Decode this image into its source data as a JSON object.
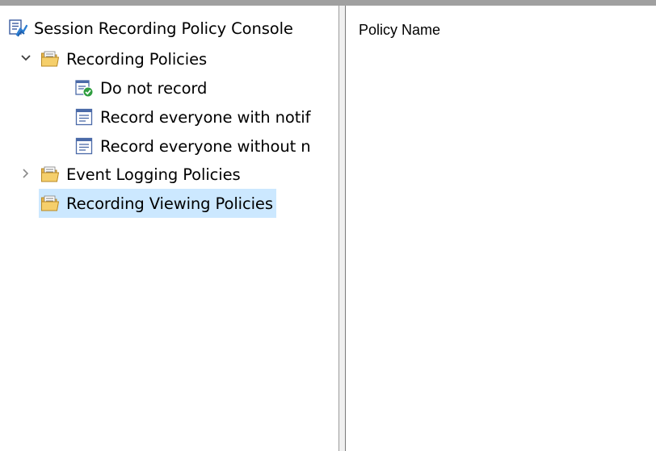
{
  "tree": {
    "root": {
      "label": "Session Recording Policy Console",
      "icon": "console-icon"
    },
    "recording_policies": {
      "label": "Recording Policies",
      "icon": "folder-icon",
      "expanded": true,
      "children": [
        {
          "label": "Do not record",
          "icon": "active-policy-icon",
          "active": true
        },
        {
          "label": "Record everyone with notif",
          "icon": "policy-icon"
        },
        {
          "label": "Record everyone without n",
          "icon": "policy-icon"
        }
      ]
    },
    "event_logging_policies": {
      "label": "Event Logging Policies",
      "icon": "folder-icon",
      "expanded": false
    },
    "recording_viewing_policies": {
      "label": "Recording Viewing Policies",
      "icon": "folder-icon",
      "selected": true
    }
  },
  "details": {
    "column_header": "Policy Name"
  },
  "colors": {
    "selection": "#cce8ff",
    "splitter": "#f0f0f0",
    "folder": "#f3c35a",
    "active_check": "#2f9e3f"
  }
}
